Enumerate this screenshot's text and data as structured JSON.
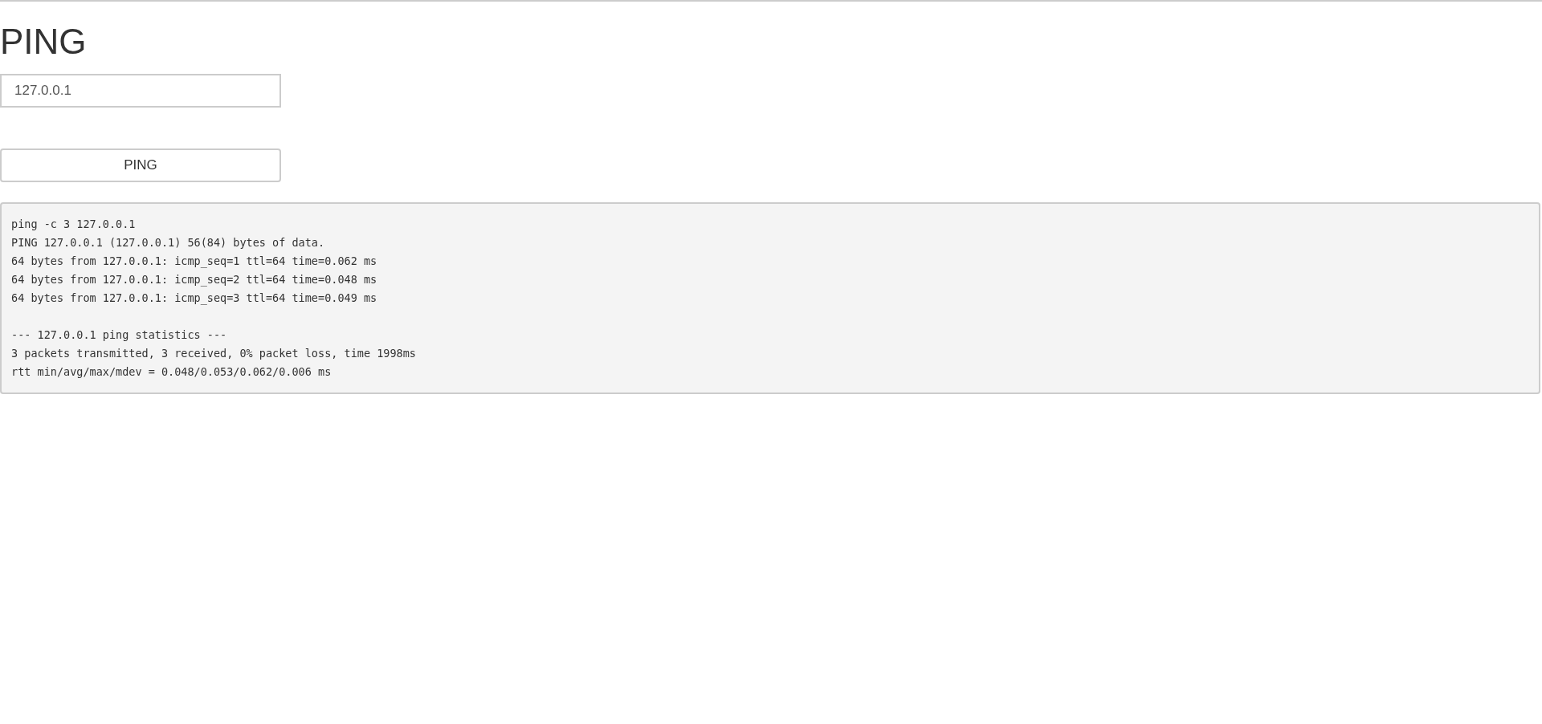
{
  "title": "PING",
  "host_field": {
    "value": "127.0.0.1"
  },
  "ping_button": {
    "label": "PING"
  },
  "output_blocks": [
    [
      "ping -c 3 127.0.0.1",
      "PING 127.0.0.1 (127.0.0.1) 56(84) bytes of data.",
      "64 bytes from 127.0.0.1: icmp_seq=1 ttl=64 time=0.062 ms",
      "64 bytes from 127.0.0.1: icmp_seq=2 ttl=64 time=0.048 ms",
      "64 bytes from 127.0.0.1: icmp_seq=3 ttl=64 time=0.049 ms"
    ],
    [
      "--- 127.0.0.1 ping statistics ---",
      "3 packets transmitted, 3 received, 0% packet loss, time 1998ms",
      "rtt min/avg/max/mdev = 0.048/0.053/0.062/0.006 ms"
    ]
  ]
}
